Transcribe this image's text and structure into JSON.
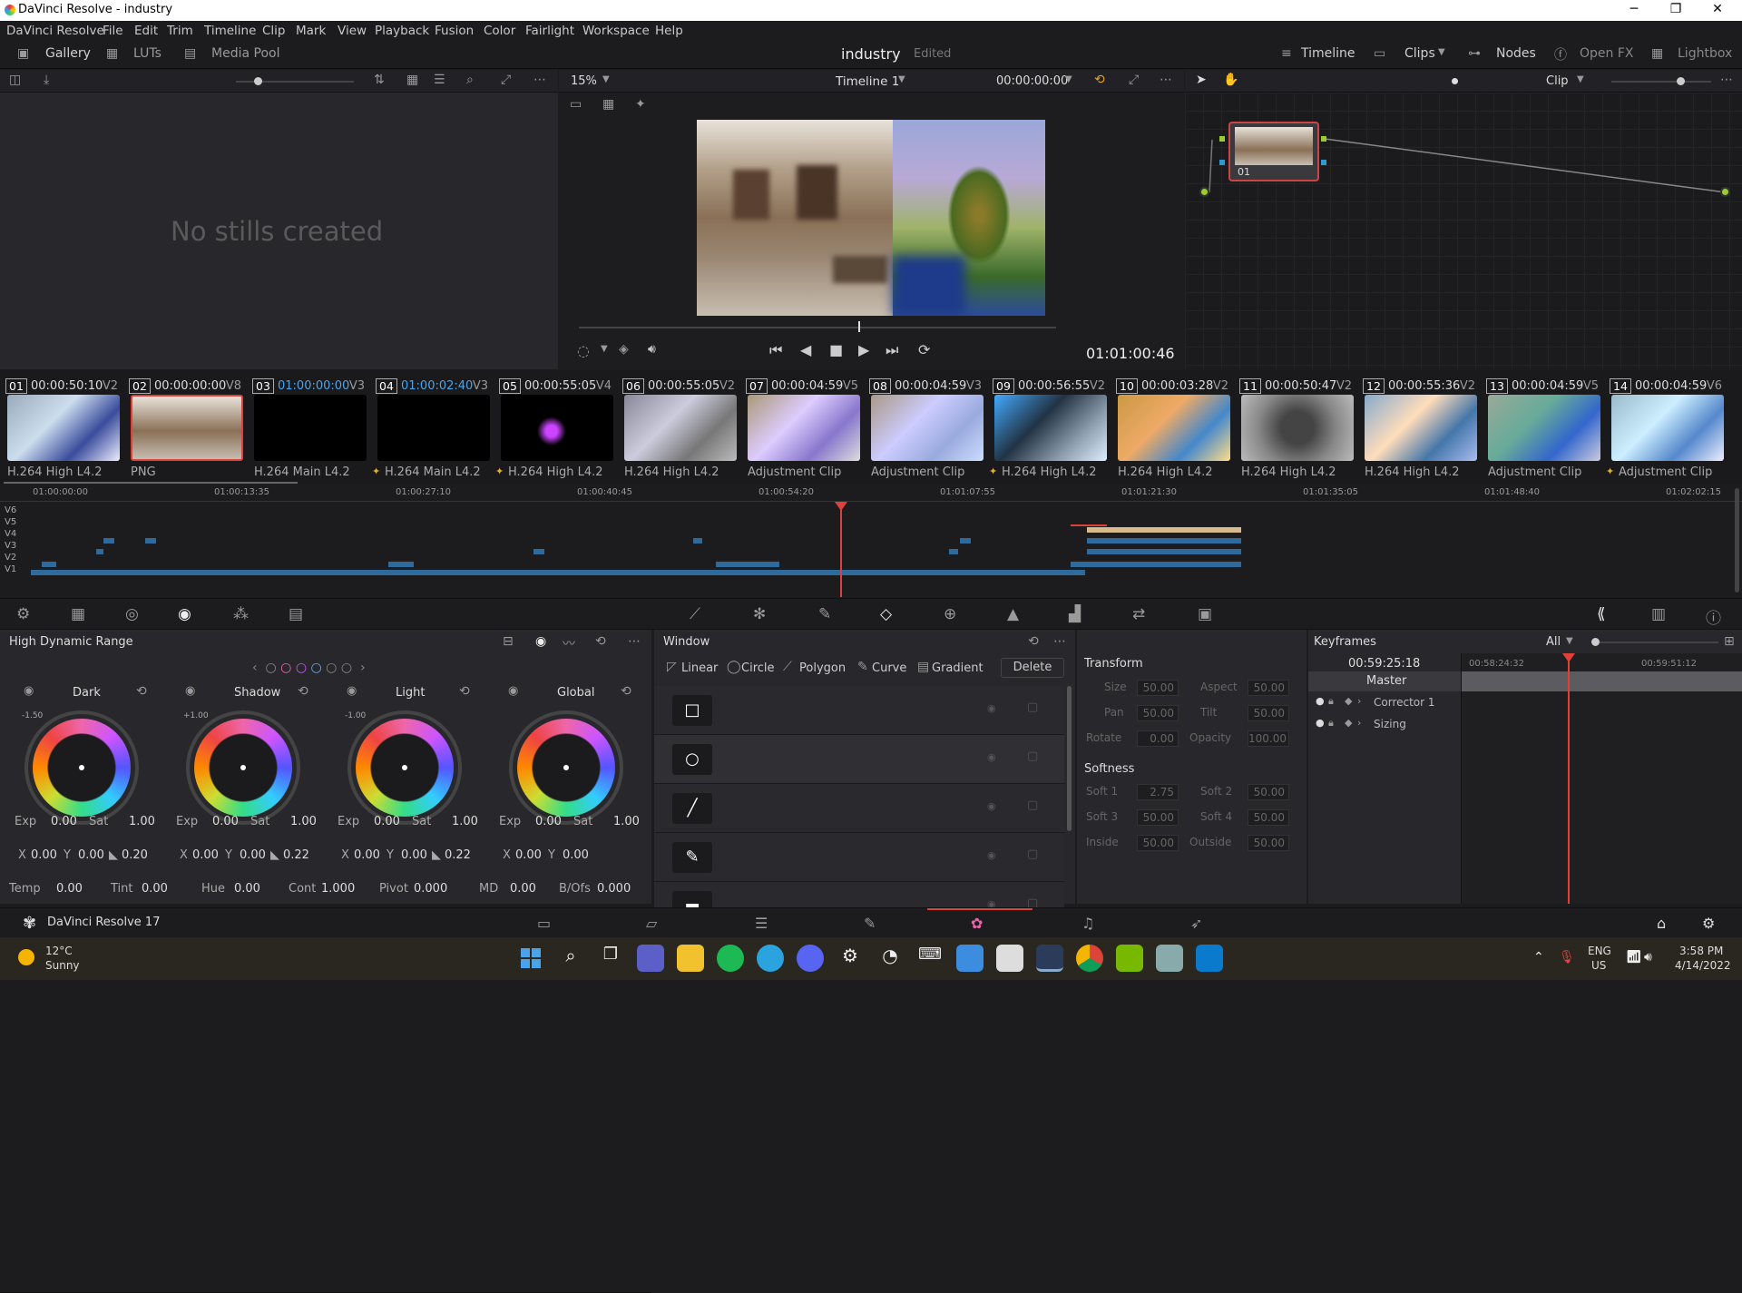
{
  "window": {
    "title": "DaVinci Resolve - industry"
  },
  "menu": [
    "DaVinci Resolve",
    "File",
    "Edit",
    "Trim",
    "Timeline",
    "Clip",
    "Mark",
    "View",
    "Playback",
    "Fusion",
    "Color",
    "Fairlight",
    "Workspace",
    "Help"
  ],
  "page_bar": {
    "gallery": "Gallery",
    "luts": "LUTs",
    "media_pool": "Media Pool",
    "project": "industry",
    "status": "Edited",
    "timeline": "Timeline",
    "clips": "Clips",
    "nodes": "Nodes",
    "open_fx": "Open FX",
    "lightbox": "Lightbox"
  },
  "viewer": {
    "zoom": "15%",
    "timeline_name": "Timeline 1",
    "timecode_top": "00:00:00:00",
    "timecode": "01:01:00:46",
    "mode": "Clip"
  },
  "stills": {
    "empty_message": "No stills created"
  },
  "node": {
    "label": "01"
  },
  "clips": [
    {
      "num": "01",
      "tc": "00:00:50:10",
      "track": "V2",
      "codec": "H.264 High L4.2",
      "fx": false
    },
    {
      "num": "02",
      "tc": "00:00:00:00",
      "track": "V8",
      "codec": "PNG",
      "fx": false
    },
    {
      "num": "03",
      "tc": "01:00:00:00",
      "track": "V3",
      "codec": "H.264 Main L4.2",
      "fx": false
    },
    {
      "num": "04",
      "tc": "01:00:02:40",
      "track": "V3",
      "codec": "H.264 Main L4.2",
      "fx": true
    },
    {
      "num": "05",
      "tc": "00:00:55:05",
      "track": "V4",
      "codec": "H.264 High L4.2",
      "fx": true
    },
    {
      "num": "06",
      "tc": "00:00:55:05",
      "track": "V2",
      "codec": "H.264 High L4.2",
      "fx": false
    },
    {
      "num": "07",
      "tc": "00:00:04:59",
      "track": "V5",
      "codec": "Adjustment Clip",
      "fx": false
    },
    {
      "num": "08",
      "tc": "00:00:04:59",
      "track": "V3",
      "codec": "Adjustment Clip",
      "fx": false
    },
    {
      "num": "09",
      "tc": "00:00:56:55",
      "track": "V2",
      "codec": "H.264 High L4.2",
      "fx": true
    },
    {
      "num": "10",
      "tc": "00:00:03:28",
      "track": "V2",
      "codec": "H.264 High L4.2",
      "fx": false
    },
    {
      "num": "11",
      "tc": "00:00:50:47",
      "track": "V2",
      "codec": "H.264 High L4.2",
      "fx": false
    },
    {
      "num": "12",
      "tc": "00:00:55:36",
      "track": "V2",
      "codec": "H.264 High L4.2",
      "fx": false
    },
    {
      "num": "13",
      "tc": "00:00:04:59",
      "track": "V5",
      "codec": "Adjustment Clip",
      "fx": false
    },
    {
      "num": "14",
      "tc": "00:00:04:59",
      "track": "V6",
      "codec": "Adjustment Clip",
      "fx": true
    }
  ],
  "mini_timeline": {
    "ticks": [
      "01:00:00:00",
      "01:00:13:35",
      "01:00:27:10",
      "01:00:40:45",
      "01:00:54:20",
      "01:01:07:55",
      "01:01:21:30",
      "01:01:35:05",
      "01:01:48:40",
      "01:02:02:15"
    ],
    "tracks": [
      "V6",
      "V5",
      "V4",
      "V3",
      "V2",
      "V1"
    ]
  },
  "hdr": {
    "title": "High Dynamic Range",
    "wheels": [
      {
        "name": "Dark",
        "value": "-1.50",
        "exp": "0.00",
        "sat": "1.00",
        "x": "0.00",
        "y": "0.00",
        "z": "0.20"
      },
      {
        "name": "Shadow",
        "value": "+1.00",
        "exp": "0.00",
        "sat": "1.00",
        "x": "0.00",
        "y": "0.00",
        "z": "0.22"
      },
      {
        "name": "Light",
        "value": "-1.00",
        "exp": "0.00",
        "sat": "1.00",
        "x": "0.00",
        "y": "0.00",
        "z": "0.22"
      },
      {
        "name": "Global",
        "value": "",
        "exp": "0.00",
        "sat": "1.00",
        "x": "0.00",
        "y": "0.00",
        "z": ""
      }
    ],
    "labels": {
      "exp": "Exp",
      "sat": "Sat",
      "x": "X",
      "y": "Y"
    },
    "bottom": {
      "temp_l": "Temp",
      "temp": "0.00",
      "tint_l": "Tint",
      "tint": "0.00",
      "hue_l": "Hue",
      "hue": "0.00",
      "cont_l": "Cont",
      "cont": "1.000",
      "pivot_l": "Pivot",
      "pivot": "0.000",
      "md_l": "MD",
      "md": "0.00",
      "bofs_l": "B/Ofs",
      "bofs": "0.000"
    }
  },
  "window_panel": {
    "title": "Window",
    "shapes": [
      "Linear",
      "Circle",
      "Polygon",
      "Curve",
      "Gradient"
    ],
    "delete": "Delete"
  },
  "transform": {
    "title": "Transform",
    "rows": [
      [
        "Size",
        "50.00",
        "Aspect",
        "50.00"
      ],
      [
        "Pan",
        "50.00",
        "Tilt",
        "50.00"
      ],
      [
        "Rotate",
        "0.00",
        "Opacity",
        "100.00"
      ]
    ],
    "softness_title": "Softness",
    "soft_rows": [
      [
        "Soft 1",
        "2.75",
        "Soft 2",
        "50.00"
      ],
      [
        "Soft 3",
        "50.00",
        "Soft 4",
        "50.00"
      ],
      [
        "Inside",
        "50.00",
        "Outside",
        "50.00"
      ]
    ]
  },
  "keyframes": {
    "title": "Keyframes",
    "filter": "All",
    "timecode": "00:59:25:18",
    "ruler": [
      "00:58:24:32",
      "00:59:51:12"
    ],
    "tracks": [
      "Master",
      "Corrector 1",
      "Sizing"
    ]
  },
  "status": {
    "app": "DaVinci Resolve 17"
  },
  "taskbar": {
    "temp": "12°C",
    "weather": "Sunny",
    "lang1": "ENG",
    "lang2": "US",
    "time": "3:58 PM",
    "date": "4/14/2022"
  },
  "colors": {
    "accent": "#e0403a",
    "playhead": "#e0403a",
    "panel": "#28282c"
  }
}
